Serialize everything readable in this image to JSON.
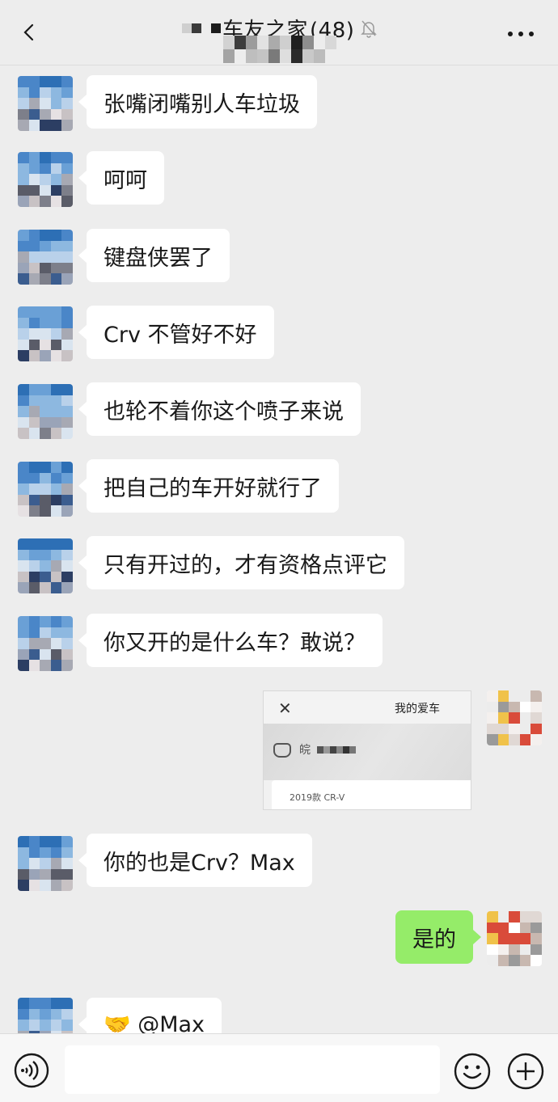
{
  "header": {
    "title": "车友之家",
    "member_count": "(48)",
    "back_icon": "chevron-left-icon",
    "mute_icon": "bell-muted-icon",
    "more_icon": "more-dots-icon"
  },
  "messages": [
    {
      "side": "left",
      "text": "张嘴闭嘴别人车垃圾"
    },
    {
      "side": "left",
      "text": "呵呵"
    },
    {
      "side": "left",
      "text": "键盘侠罢了"
    },
    {
      "side": "left",
      "text": "Crv 不管好不好"
    },
    {
      "side": "left",
      "text": "也轮不着你这个喷子来说"
    },
    {
      "side": "left",
      "text": "把自己的车开好就行了"
    },
    {
      "side": "left",
      "text": "只有开过的，才有资格点评它"
    },
    {
      "side": "left",
      "text": "你又开的是什么车？敢说？"
    },
    {
      "side": "right",
      "type": "image",
      "card": {
        "title": "我的爱车",
        "plate": "皖",
        "model": "2019款 CR-V"
      }
    },
    {
      "side": "left",
      "text": "你的也是Crv？Max"
    },
    {
      "side": "right",
      "text": "是的"
    },
    {
      "side": "left",
      "text": "🤝 @Max"
    }
  ],
  "input_bar": {
    "voice_icon": "voice-icon",
    "emoji_icon": "emoji-icon",
    "plus_icon": "plus-icon",
    "placeholder": ""
  },
  "colors": {
    "background": "#ededed",
    "bubble_left": "#ffffff",
    "bubble_self": "#95ec69",
    "avatar_blue": "#2d6fb5"
  }
}
